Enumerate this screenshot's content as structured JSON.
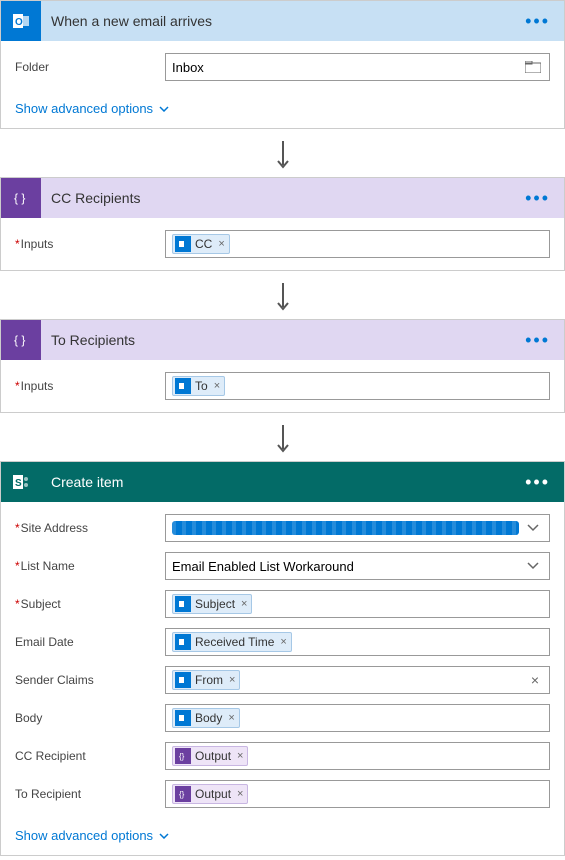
{
  "step1": {
    "title": "When a new email arrives",
    "folder_label": "Folder",
    "folder_value": "Inbox",
    "adv": "Show advanced options"
  },
  "step2": {
    "title": "CC Recipients",
    "inputs_label": "Inputs",
    "token": "CC"
  },
  "step3": {
    "title": "To Recipients",
    "inputs_label": "Inputs",
    "token": "To"
  },
  "step4": {
    "title": "Create item",
    "site_label": "Site Address",
    "listname_label": "List Name",
    "listname_value": "Email Enabled List Workaround",
    "subject_label": "Subject",
    "subject_token": "Subject",
    "emaildate_label": "Email Date",
    "emaildate_token": "Received Time",
    "sender_label": "Sender Claims",
    "sender_token": "From",
    "body_label": "Body",
    "body_token": "Body",
    "cc_label": "CC Recipient",
    "cc_token": "Output",
    "to_label": "To Recipient",
    "to_token": "Output",
    "adv": "Show advanced options"
  }
}
